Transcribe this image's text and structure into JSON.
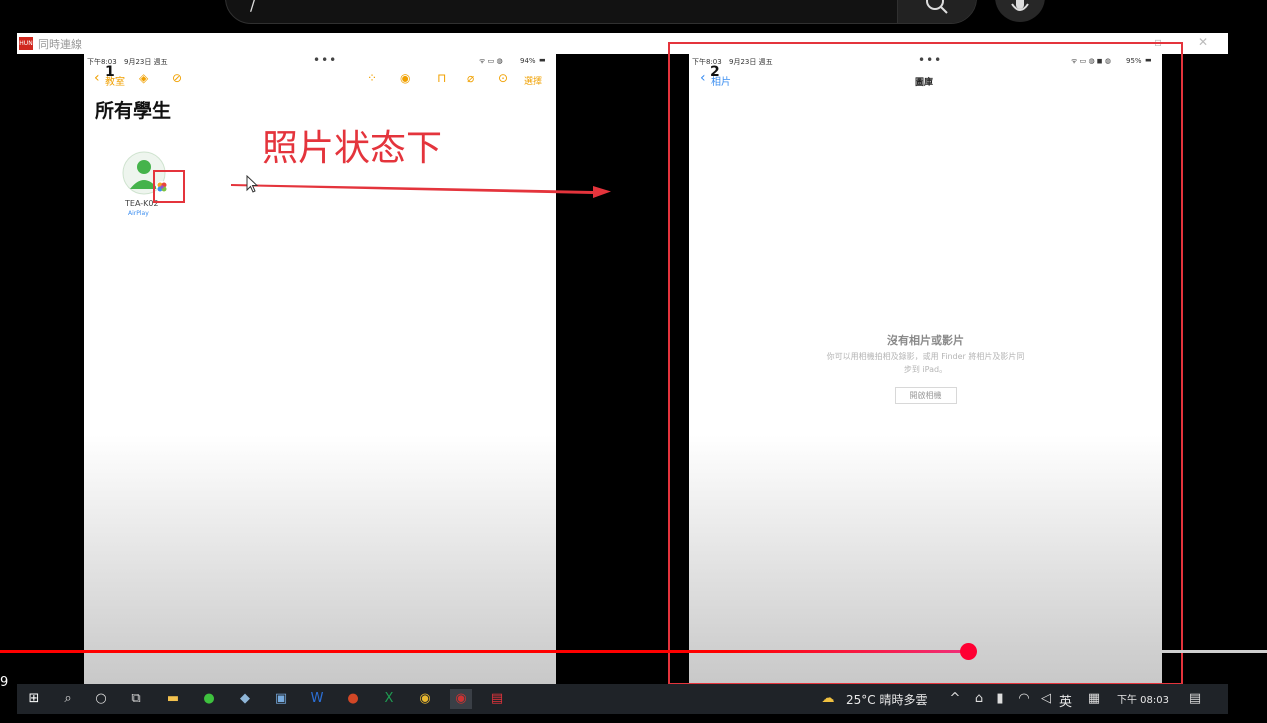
{
  "video_chrome": {
    "left_time_fragment": "9"
  },
  "window": {
    "logo_text": "HUN",
    "title": "同時連線"
  },
  "ipad1": {
    "time": "下午8:03",
    "date": "9月23日 週五",
    "more_dots": "•••",
    "battery": "94%",
    "back_label": "教室",
    "select_label": "選擇",
    "page_title": "所有學生",
    "student_name": "TEA-K02",
    "student_status": "AirPlay",
    "number_marker": "1"
  },
  "annotation": {
    "text": "照片状态下"
  },
  "ipad2": {
    "time": "下午8:03",
    "date": "9月23日 週五",
    "more_dots": "•••",
    "battery": "95%",
    "back_label": "相片",
    "nav_title": "圖庫",
    "empty_title": "沒有相片或影片",
    "empty_body_line1": "你可以用相機拍相及錄影，或用 Finder 將相片及影片同",
    "empty_body_line2": "步到 iPad。",
    "open_camera_label": "開啟相機",
    "number_marker": "2"
  },
  "taskbar": {
    "weather": "25°C  晴時多雲",
    "ime": "英",
    "clock": "下午 08:03"
  },
  "colors": {
    "accent_red": "#e4343c",
    "ipad_orange": "#f0a000",
    "ipad_blue": "#3a8df0"
  }
}
